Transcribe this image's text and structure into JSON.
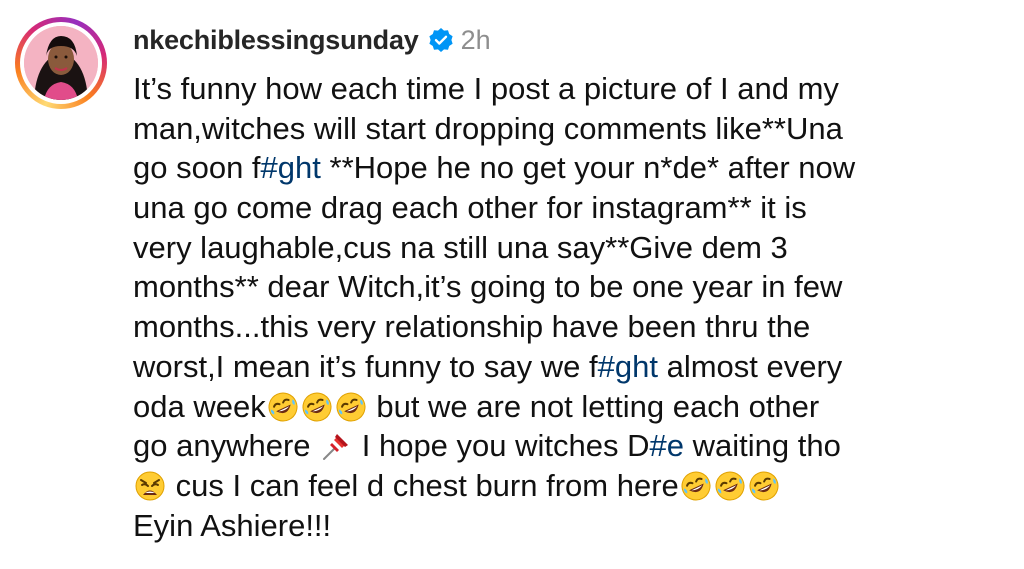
{
  "post": {
    "username": "nkechiblessingsunday",
    "verified_icon": "verified-badge-icon",
    "time_ago": "2h",
    "accent_color": "#0095f6",
    "hashtag_color": "#00376b",
    "avatar_icon": "profile-photo",
    "caption": {
      "line1": "It’s funny how each time I post a picture of I and my",
      "line2": "man,witches will start dropping comments like**Una",
      "line3_a": "go soon f",
      "line3_tag": "#ght",
      "line3_b": " **Hope he no get your n*de* after now",
      "line4": "una go come drag each other for instagram** it is",
      "line5": "very laughable,cus na still una say**Give dem 3",
      "line6": "months** dear Witch,it’s going to be one year in few",
      "line7": "months...this very relationship have been thru the",
      "line8_a": "worst,I mean it’s funny to say we f",
      "line8_tag": "#ght",
      "line8_b": " almost every",
      "line9_a": "oda week",
      "line9_b": " but we are not letting each other",
      "line10_a": "go anywhere ",
      "line10_b": " I hope you witches D",
      "line10_tag": "#e",
      "line10_c": " waiting tho",
      "line11_a": " cus I can feel d chest burn from here",
      "line12": "Eyin Ashiere!!!"
    },
    "emoji_names": [
      "rolling-on-floor-laughing-emoji",
      "pushpin-emoji",
      "weary-face-emoji"
    ]
  }
}
